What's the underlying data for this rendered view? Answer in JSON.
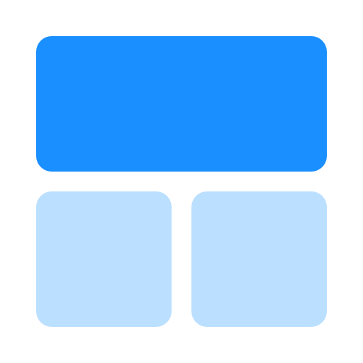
{
  "icon": {
    "name": "dashboard-layout-icon",
    "colors": {
      "primary": "#1A8FFF",
      "secondary": "#BBDFFF",
      "background": "#FFFFFF"
    }
  }
}
